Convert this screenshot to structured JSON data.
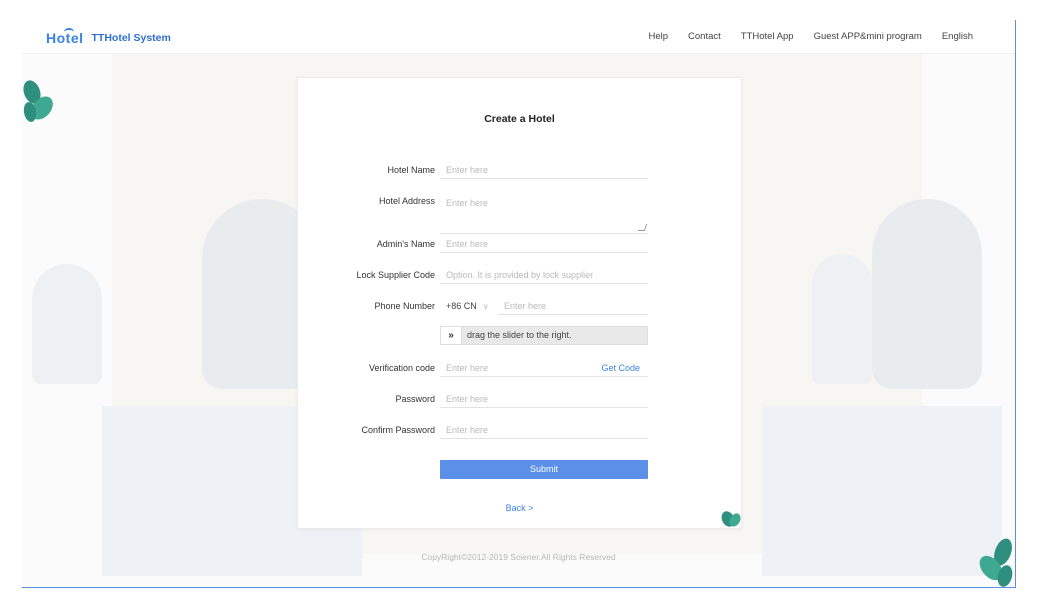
{
  "header": {
    "logo_text": "Hotel",
    "title": "TTHotel System",
    "nav": [
      "Help",
      "Contact",
      "TTHotel App",
      "Guest APP&mini program",
      "English"
    ]
  },
  "form": {
    "title": "Create a Hotel",
    "hotel_name": {
      "label": "Hotel Name",
      "placeholder": "Enter here"
    },
    "hotel_address": {
      "label": "Hotel Address",
      "placeholder": "Enter here"
    },
    "admin_name": {
      "label": "Admin's Name",
      "placeholder": "Enter here"
    },
    "lock_supplier": {
      "label": "Lock Supplier Code",
      "placeholder": "Option. It is provided by lock supplier"
    },
    "phone": {
      "label": "Phone Number",
      "country_code": "+86 CN",
      "placeholder": "Enter here"
    },
    "slider": {
      "handle": "»",
      "text": "drag the slider to the right."
    },
    "verification": {
      "label": "Verification code",
      "placeholder": "Enter here",
      "get_code": "Get Code"
    },
    "password": {
      "label": "Password",
      "placeholder": "Enter here"
    },
    "confirm_password": {
      "label": "Confirm Password",
      "placeholder": "Enter here"
    },
    "submit": "Submit",
    "back": "Back >"
  },
  "footer": {
    "copyright": "CopyRight©2012-2019 Sciener.All Rights Reserved"
  },
  "colors": {
    "accent": "#3a83e0",
    "submit": "#5b8fe8",
    "leaf": "#2f8f7f"
  }
}
